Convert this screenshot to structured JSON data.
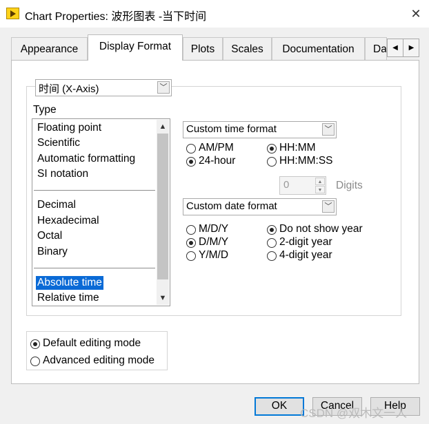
{
  "window": {
    "title": "Chart Properties: 波形图表 -当下时间",
    "close_glyph": "✕"
  },
  "tabs": [
    {
      "label": "Appearance",
      "active": false
    },
    {
      "label": "Display Format",
      "active": true
    },
    {
      "label": "Plots",
      "active": false
    },
    {
      "label": "Scales",
      "active": false
    },
    {
      "label": "Documentation",
      "active": false
    },
    {
      "label": "Da",
      "active": false
    }
  ],
  "tab_scroll": {
    "left": "◀",
    "right": "▶"
  },
  "axis_select": {
    "value": "时间 (X-Axis)",
    "arrow": "﹀"
  },
  "type_section": {
    "label": "Type",
    "groups": [
      [
        "Floating point",
        "Scientific",
        "Automatic formatting",
        "SI notation"
      ],
      [
        "Decimal",
        "Hexadecimal",
        "Octal",
        "Binary"
      ],
      [
        "Absolute time",
        "Relative time"
      ]
    ],
    "selected": "Absolute time",
    "scroll_up": "▲",
    "scroll_down": "▼"
  },
  "time_format": {
    "select_value": "Custom time format",
    "options": {
      "ampm": {
        "label": "AM/PM",
        "checked": false
      },
      "h24": {
        "label": "24-hour",
        "checked": true
      },
      "hhmm": {
        "label": "HH:MM",
        "checked": true
      },
      "hhmmss": {
        "label": "HH:MM:SS",
        "checked": false
      }
    },
    "digits": {
      "value": "0",
      "label": "Digits"
    }
  },
  "date_format": {
    "select_value": "Custom date format",
    "options": {
      "mdy": {
        "label": "M/D/Y",
        "checked": false
      },
      "dmy": {
        "label": "D/M/Y",
        "checked": true
      },
      "ymd": {
        "label": "Y/M/D",
        "checked": false
      },
      "noyear": {
        "label": "Do not show year",
        "checked": true
      },
      "y2": {
        "label": "2-digit year",
        "checked": false
      },
      "y4": {
        "label": "4-digit year",
        "checked": false
      }
    }
  },
  "editing_mode": {
    "default": {
      "label": "Default editing mode",
      "checked": true
    },
    "advanced": {
      "label": "Advanced editing mode",
      "checked": false
    }
  },
  "buttons": {
    "ok": "OK",
    "cancel": "Cancel",
    "help": "Help"
  },
  "watermark": "CSDN @双木文一人",
  "colors": {
    "selection": "#0a6ad6",
    "default_button_border": "#0078d7"
  }
}
